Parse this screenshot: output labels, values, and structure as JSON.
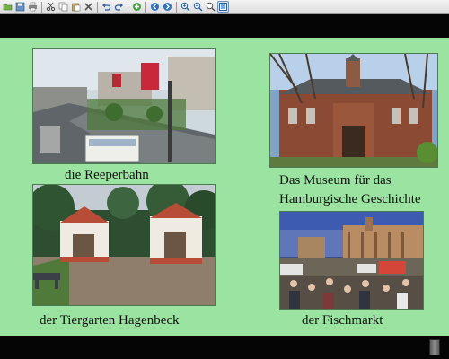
{
  "toolbar": {
    "buttons": [
      {
        "icon": "open-folder-icon"
      },
      {
        "icon": "save-icon"
      },
      {
        "icon": "print-icon"
      },
      {
        "icon": "cut-icon"
      },
      {
        "icon": "copy-icon"
      },
      {
        "icon": "paste-icon"
      },
      {
        "icon": "delete-icon"
      },
      {
        "icon": "undo-icon"
      },
      {
        "icon": "redo-icon"
      },
      {
        "icon": "add-icon"
      },
      {
        "icon": "back-icon"
      },
      {
        "icon": "forward-icon"
      },
      {
        "icon": "zoom-in-icon"
      },
      {
        "icon": "zoom-out-icon"
      },
      {
        "icon": "search-icon"
      },
      {
        "icon": "fit-page-icon"
      }
    ]
  },
  "slide": {
    "background": "#9be3a0",
    "items": [
      {
        "caption": "die Reeperbahn"
      },
      {
        "caption_line1": "Das Museum für das",
        "caption_line2": "Hamburgische Geschichte"
      },
      {
        "caption": "der Tiergarten Hagenbeck"
      },
      {
        "caption": "der Fischmarkt"
      }
    ]
  }
}
